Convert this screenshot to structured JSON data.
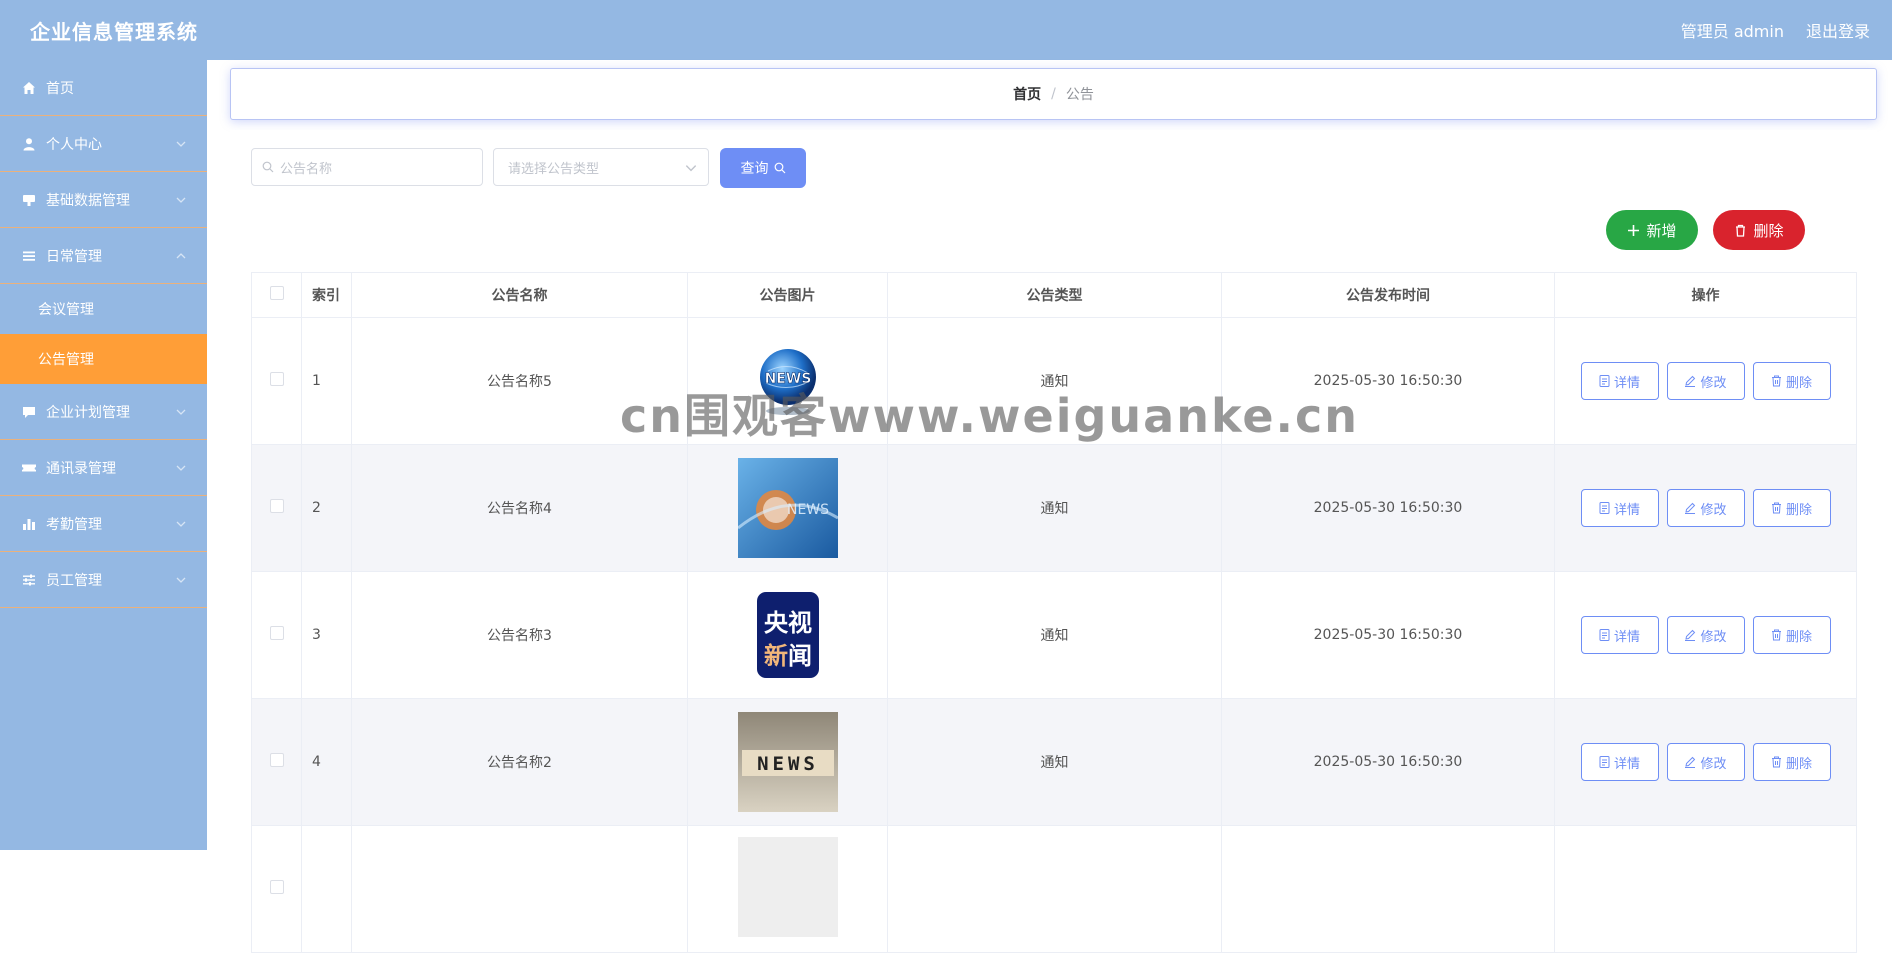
{
  "header": {
    "app_title": "企业信息管理系统",
    "admin_label": "管理员 admin",
    "logout_label": "退出登录"
  },
  "sidebar": {
    "items": [
      {
        "label": "首页",
        "icon": "home-icon"
      },
      {
        "label": "个人中心",
        "icon": "user-icon"
      },
      {
        "label": "基础数据管理",
        "icon": "data-icon"
      },
      {
        "label": "日常管理",
        "icon": "list-icon",
        "expanded": true
      },
      {
        "label": "企业计划管理",
        "icon": "chat-icon"
      },
      {
        "label": "通讯录管理",
        "icon": "ticket-icon"
      },
      {
        "label": "考勤管理",
        "icon": "bar-chart-icon"
      },
      {
        "label": "员工管理",
        "icon": "sliders-icon"
      }
    ],
    "submenu": [
      {
        "label": "会议管理",
        "active": false
      },
      {
        "label": "公告管理",
        "active": true
      }
    ]
  },
  "breadcrumb": {
    "home": "首页",
    "separator": "/",
    "current": "公告"
  },
  "search": {
    "name_placeholder": "公告名称",
    "type_placeholder": "请选择公告类型",
    "query_label": "查询"
  },
  "actions": {
    "add_label": "新增",
    "delete_label": "删除"
  },
  "table": {
    "headers": {
      "index": "索引",
      "name": "公告名称",
      "image": "公告图片",
      "type": "公告类型",
      "time": "公告发布时间",
      "ops": "操作"
    },
    "rows": [
      {
        "index": "1",
        "name": "公告名称5",
        "type": "通知",
        "time": "2025-05-30 16:50:30",
        "image": "globe-news"
      },
      {
        "index": "2",
        "name": "公告名称4",
        "type": "通知",
        "time": "2025-05-30 16:50:30",
        "image": "blue-news"
      },
      {
        "index": "3",
        "name": "公告名称3",
        "type": "通知",
        "time": "2025-05-30 16:50:30",
        "image": "cctv-news"
      },
      {
        "index": "4",
        "name": "公告名称2",
        "type": "通知",
        "time": "2025-05-30 16:50:30",
        "image": "news-blocks"
      }
    ],
    "op_labels": {
      "detail": "详情",
      "edit": "修改",
      "delete": "删除"
    }
  },
  "images": {
    "cctv_line1": "央视",
    "cctv_line2_a": "新",
    "cctv_line2_b": "闻",
    "globe_text": "NEWS",
    "blue_text": "NEWS",
    "blocks_text": "NEWS"
  },
  "watermark": "cn围观客www.weiguanke.cn",
  "colors": {
    "header_bg": "#94b8e3",
    "sidebar_bg": "#94b8e3",
    "active_menu": "#ff9e37",
    "primary": "#6e8ef5",
    "success": "#28a745",
    "danger": "#d9232d"
  }
}
